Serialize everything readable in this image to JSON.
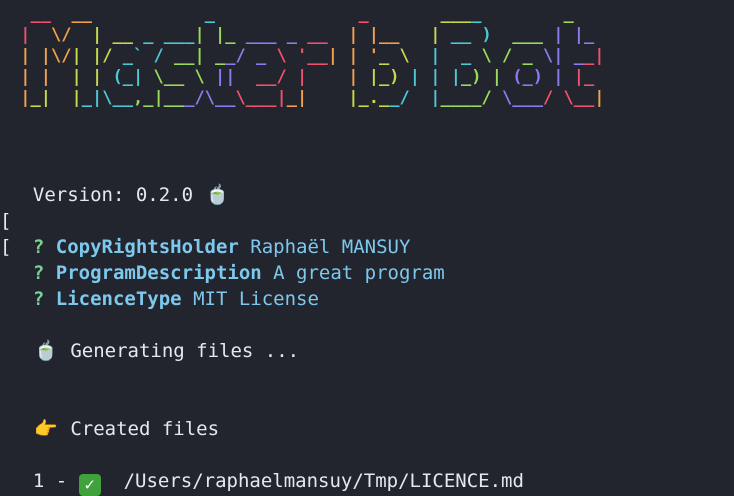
{
  "banner": {
    "lines": [
      "  __  __           _              _       ____        _   ",
      " |  \\/  | __ _ ___| |_ ___ _ __  | |__   | __ )  ___ | |_ ",
      " | |\\/| |/ _` / __| __/ _ \\ '__| | '_ \\  |  _ \\ / _ \\| __|",
      " | |  | | (_| \\__ \\ ||  __/ |    | |_) | | |_) | (_) | |_ ",
      " |_|  |_|\\__,_|___/\\__\\___|_|    |_.__/  |____/ \\___/ \\__|"
    ],
    "colors": [
      "#f0506e",
      "#f5a04a",
      "#c8d94a",
      "#4cc9d6",
      "#9bdb5a",
      "#8b7cf0"
    ]
  },
  "version": {
    "text": "Version: 0.2.0",
    "icon": "tea-cup-icon",
    "icon_glyph": "🍵"
  },
  "prompts": [
    {
      "bracket": "[",
      "mark": "?",
      "key": "CopyRightsHolder",
      "value": "Raphaël MANSUY"
    },
    {
      "bracket": "[",
      "mark": "?",
      "key": "ProgramDescription",
      "value": "A great program"
    },
    {
      "bracket": "",
      "mark": "?",
      "key": "LicenceType",
      "value": "MIT License"
    }
  ],
  "generating": {
    "icon": "tea-cup-icon",
    "icon_glyph": "🍵",
    "text": "Generating files ..."
  },
  "created": {
    "icon": "pointing-hand-icon",
    "icon_glyph": "👉",
    "text": "Created files"
  },
  "files": [
    {
      "index": "1 -",
      "icon": "check-mark-icon",
      "icon_glyph": "✓",
      "path": "/Users/raphaelmansuy/Tmp/LICENCE.md"
    }
  ],
  "colors": {
    "background": "#22252d",
    "text": "#e6e8ec",
    "key": "#7ec8ee",
    "question": "#76d38f",
    "check": "#3fa23a"
  }
}
